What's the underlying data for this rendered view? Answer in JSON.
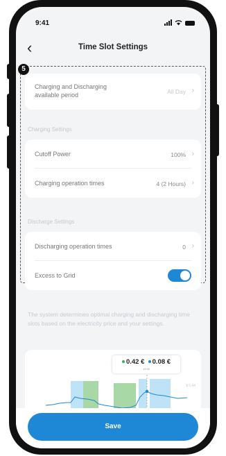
{
  "status_bar": {
    "time": "9:41"
  },
  "header": {
    "title": "Time Slot Settings"
  },
  "annotation": {
    "marker": "5"
  },
  "period": {
    "label_line1": "Charging and Discharging",
    "label_line2": "available period",
    "value": "All Day"
  },
  "charging": {
    "section_title": "Charging Settings",
    "cutoff_label": "Cutoff Power",
    "cutoff_value": "100%",
    "times_label": "Charging operation times",
    "times_value": "4 (2 Hours)"
  },
  "discharge": {
    "section_title": "Discharge Settings",
    "times_label": "Discharging operation times",
    "times_value": "0",
    "excess_label": "Excess to Grid",
    "excess_enabled": true
  },
  "description": "The system determines optimal charging and discharging time slots based on the electricity price and your settings.",
  "price_chart": {
    "price_charge": "0.42 €",
    "price_discharge": "0.08 €",
    "time_label": "19:30",
    "axis_value": "$ 0.44",
    "colors": {
      "charge_dot": "#3cae5c",
      "discharge_dot": "#1e88d6",
      "charge_band": "#a8d8a6",
      "discharge_band": "#bfe3f6"
    }
  },
  "save_button": {
    "label": "Save"
  },
  "colors": {
    "accent": "#1e88d6",
    "background": "#f3f4f6"
  }
}
